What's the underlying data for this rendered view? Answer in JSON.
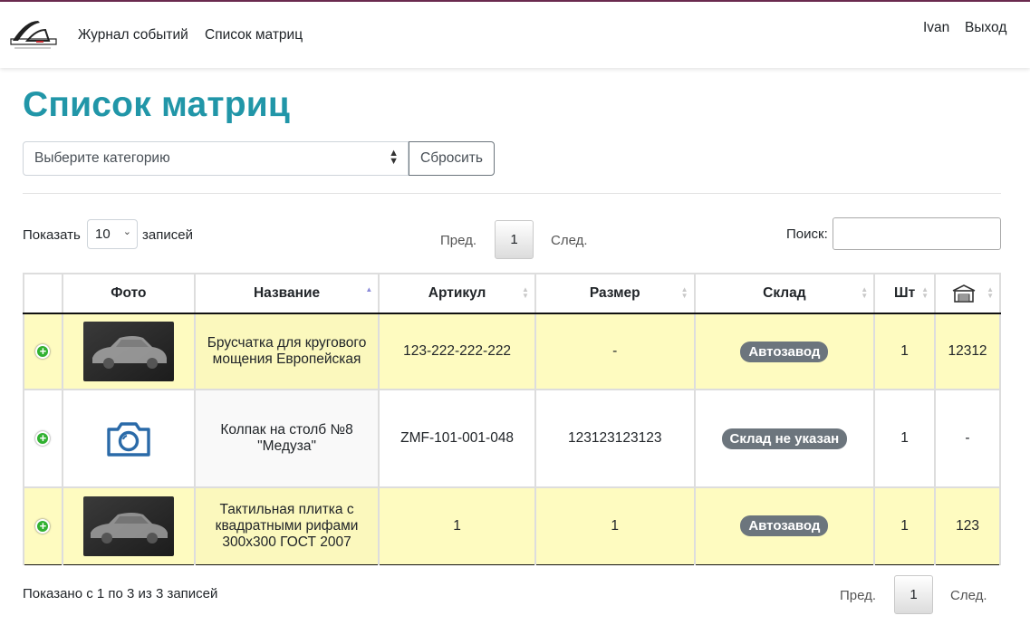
{
  "nav": {
    "links": [
      "Журнал событий",
      "Список матриц"
    ],
    "user": "Ivan",
    "logout": "Выход"
  },
  "page": {
    "title": "Список матриц",
    "category_placeholder": "Выберите категорию",
    "reset_label": "Сбросить"
  },
  "table_controls": {
    "show_label": "Показать",
    "length_value": "10",
    "records_label": "записей",
    "prev": "Пред.",
    "current_page": "1",
    "next": "След.",
    "search_label": "Поиск:",
    "search_value": ""
  },
  "columns": [
    "",
    "Фото",
    "Название",
    "Артикул",
    "Размер",
    "Склад",
    "Шт",
    "warehouse-icon"
  ],
  "rows": [
    {
      "photo": "car-photo",
      "name": "Брусчатка для кругового мощения Европейская",
      "article": "123-222-222-222",
      "size": "-",
      "warehouse": "Автозавод",
      "qty": "1",
      "stock": "12312"
    },
    {
      "photo": "camera-icon",
      "name": "Колпак на столб №8 \"Медуза\"",
      "article": "ZMF-101-001-048",
      "size": "123123123123",
      "warehouse": "Склад не указан",
      "qty": "1",
      "stock": "-"
    },
    {
      "photo": "car-photo",
      "name": "Тактильная плитка с квадратными рифами 300х300 ГОСТ 2007",
      "article": "1",
      "size": "1",
      "warehouse": "Автозавод",
      "qty": "1",
      "stock": "123"
    }
  ],
  "footer": {
    "info": "Показано с 1 по 3 из 3 записей",
    "prev": "Пред.",
    "current_page": "1",
    "next": "След."
  },
  "colors": {
    "title": "#2196a8",
    "row_highlight": "#fefbc0",
    "badge": "#6c757d",
    "expand_icon": "#31b131",
    "camera_icon": "#2a6aa8"
  }
}
